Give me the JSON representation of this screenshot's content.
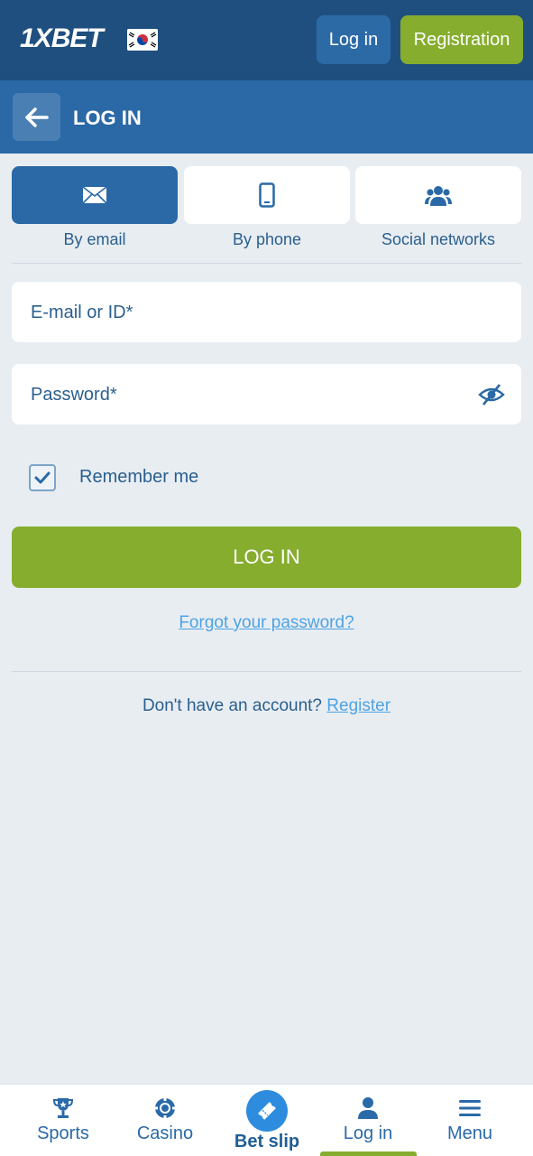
{
  "header": {
    "logo_prefix": "1X",
    "logo_suffix": "BET",
    "login_label": "Log in",
    "registration_label": "Registration"
  },
  "section": {
    "title": "LOG IN"
  },
  "tabs": [
    {
      "label": "By email",
      "icon": "envelope-icon",
      "active": true
    },
    {
      "label": "By phone",
      "icon": "phone-icon",
      "active": false
    },
    {
      "label": "Social networks",
      "icon": "users-icon",
      "active": false
    }
  ],
  "form": {
    "email_placeholder": "E-mail or ID*",
    "password_placeholder": "Password*",
    "remember_label": "Remember me",
    "remember_checked": true,
    "submit_label": "LOG IN",
    "forgot_label": "Forgot your password?",
    "no_account_text": "Don't have an account?",
    "register_link": "Register"
  },
  "bottom_nav": [
    {
      "label": "Sports",
      "icon": "trophy-icon"
    },
    {
      "label": "Casino",
      "icon": "casino-chip-icon"
    },
    {
      "label": "Bet slip",
      "icon": "ticket-icon"
    },
    {
      "label": "Log in",
      "icon": "user-icon",
      "active": true
    },
    {
      "label": "Menu",
      "icon": "menu-icon"
    }
  ],
  "colors": {
    "topbar": "#1f4f7e",
    "header": "#2a69a6",
    "accent_green": "#86ad2e",
    "link_blue": "#4ea3e3",
    "text_blue": "#2a5f8f"
  }
}
